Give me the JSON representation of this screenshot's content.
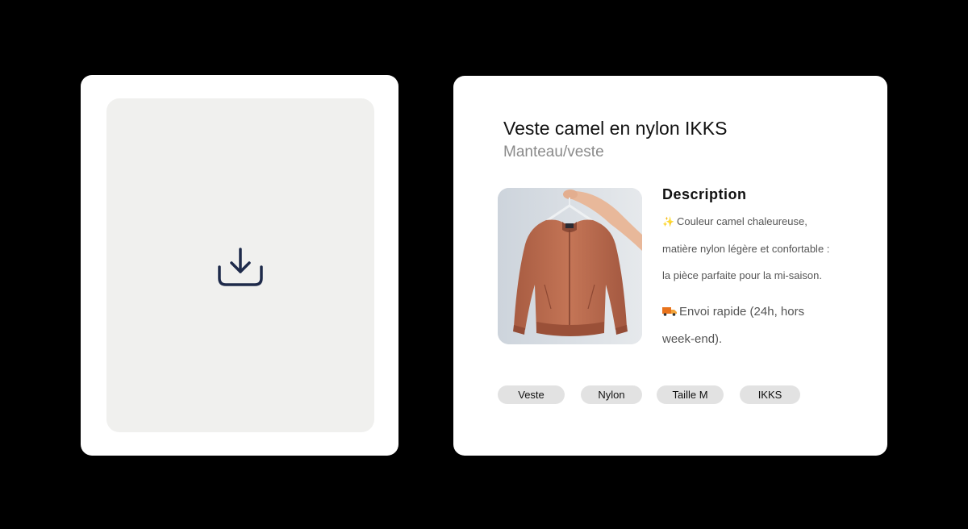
{
  "upload": {
    "icon": "download-icon",
    "icon_color": "#1e2a4a"
  },
  "product": {
    "title": "Veste camel en nylon IKKS",
    "category": "Manteau/veste",
    "image": "camel-jacket-photo",
    "description": {
      "heading": "Description",
      "lines": [
        "Couleur camel chaleureuse,",
        "matière nylon légère et confortable :",
        "la pièce parfaite pour la mi-saison."
      ],
      "shipping_lines": [
        "Envoi rapide (24h, hors",
        "week-end)."
      ]
    },
    "tags": [
      "Veste",
      "Nylon",
      "Taille M",
      "IKKS"
    ]
  },
  "colors": {
    "background": "#000000",
    "card": "#ffffff",
    "dropzone": "#f0f0ee",
    "tag_bg": "#e2e2e2",
    "jacket": "#b86a4e"
  }
}
